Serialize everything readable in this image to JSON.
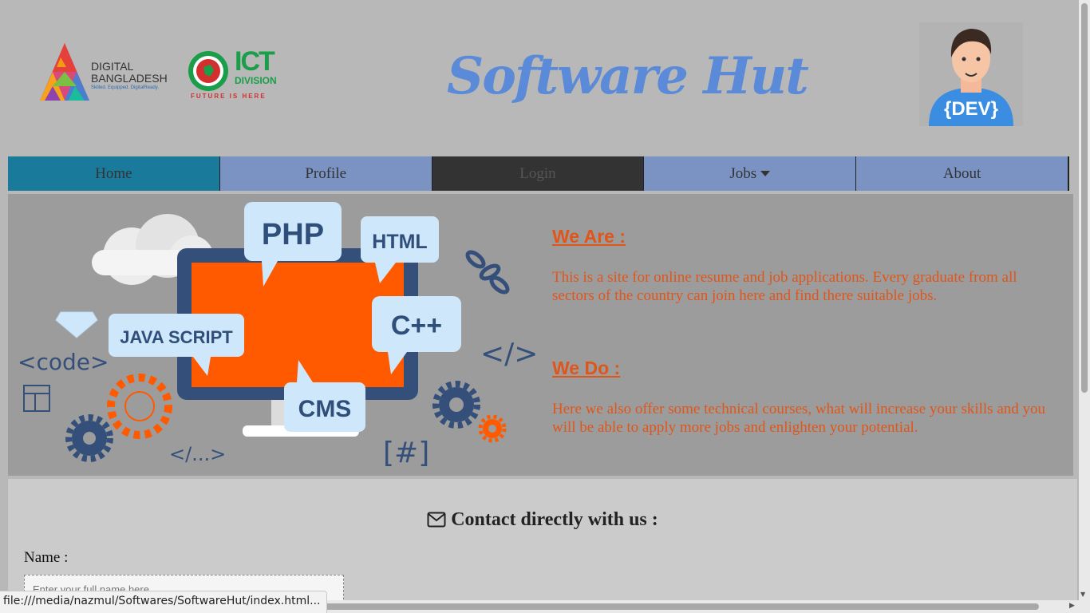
{
  "header": {
    "logo_db": {
      "title": "DIGITAL",
      "title2": "BANGLADESH",
      "tagline": "Skilled. Equipped. DigitalReady."
    },
    "logo_ict": {
      "big": "ICT",
      "sub": "DIVISION",
      "tagline": "FUTURE IS HERE"
    },
    "brand": "Software Hut",
    "avatar_label": "{DEV}"
  },
  "nav": {
    "items": [
      {
        "label": "Home"
      },
      {
        "label": "Profile"
      },
      {
        "label": "Login"
      },
      {
        "label": "Jobs"
      },
      {
        "label": "About"
      }
    ]
  },
  "hero": {
    "illustration": {
      "bubbles": [
        "PHP",
        "HTML",
        "JAVA SCRIPT",
        "C++",
        "CMS"
      ],
      "code_tag": "<code>",
      "close_tag": "</>",
      "dots_tag": "</...>",
      "hash_tag": "[#]"
    },
    "we_are_title": "We Are :",
    "we_are_text": "This is a site for online resume and job applications. Every graduate from all sectors of the country can join here and find there suitable jobs.",
    "we_do_title": "We Do :",
    "we_do_text": "Here we also offer some technical courses, what will increase your skills and you will be able to apply more jobs and enlighten your potential."
  },
  "contact": {
    "title": "Contact directly with us :",
    "name_label": "Name :",
    "name_placeholder": "Enter your full name here"
  },
  "status_url": "file:///media/nazmul/Softwares/SoftwareHut/index.html...",
  "colors": {
    "nav": "#7b93c2",
    "nav_active": "#1a7a9c",
    "accent_text": "#e0561a",
    "brand": "#5b8ad8"
  }
}
